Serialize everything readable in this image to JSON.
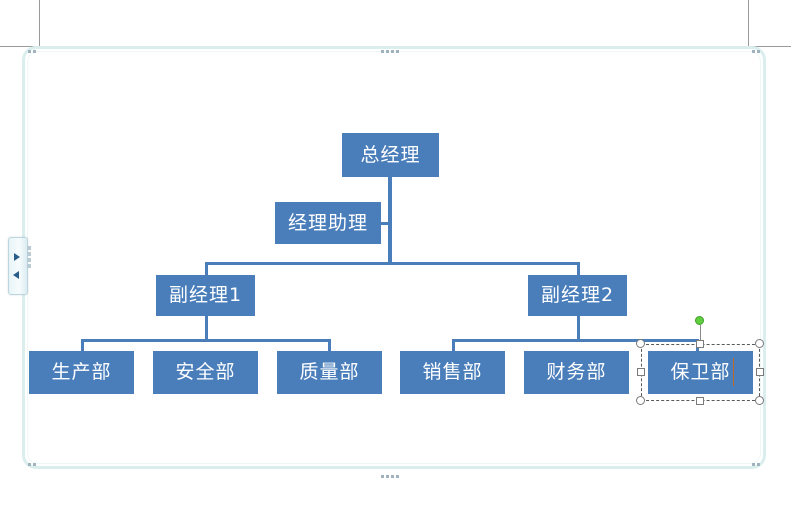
{
  "app": {
    "context": "word-smartart-organization-chart",
    "canvas_label": "smartart-drawing-canvas"
  },
  "text_pane_toggle": {
    "name": "smartart-text-pane-toggle",
    "expand_icon": "triangle-right-icon",
    "collapse_icon": "triangle-left-icon"
  },
  "chart_data": {
    "type": "diagram",
    "diagram_type": "organization-chart",
    "title": "",
    "accent_color": "#4a7ebb",
    "text_color": "#ffffff",
    "connector_color": "#4a7ebb",
    "nodes": [
      {
        "id": "ceo",
        "label": "总经理",
        "level": 0,
        "parent": null
      },
      {
        "id": "assistant",
        "label": "经理助理",
        "level": 1,
        "parent": "ceo",
        "role": "assistant"
      },
      {
        "id": "deputy1",
        "label": "副经理1",
        "level": 1,
        "parent": "ceo"
      },
      {
        "id": "deputy2",
        "label": "副经理2",
        "level": 1,
        "parent": "ceo"
      },
      {
        "id": "production",
        "label": "生产部",
        "level": 2,
        "parent": "deputy1"
      },
      {
        "id": "safety",
        "label": "安全部",
        "level": 2,
        "parent": "deputy1"
      },
      {
        "id": "quality",
        "label": "质量部",
        "level": 2,
        "parent": "deputy1"
      },
      {
        "id": "sales",
        "label": "销售部",
        "level": 2,
        "parent": "deputy2"
      },
      {
        "id": "finance",
        "label": "财务部",
        "level": 2,
        "parent": "deputy2"
      },
      {
        "id": "security",
        "label": "保卫部",
        "level": 2,
        "parent": "deputy2",
        "selected": true
      }
    ]
  },
  "selection": {
    "selected_node_label": "保卫部",
    "rotation_handle": "rotate-handle",
    "has_text_caret": true
  }
}
